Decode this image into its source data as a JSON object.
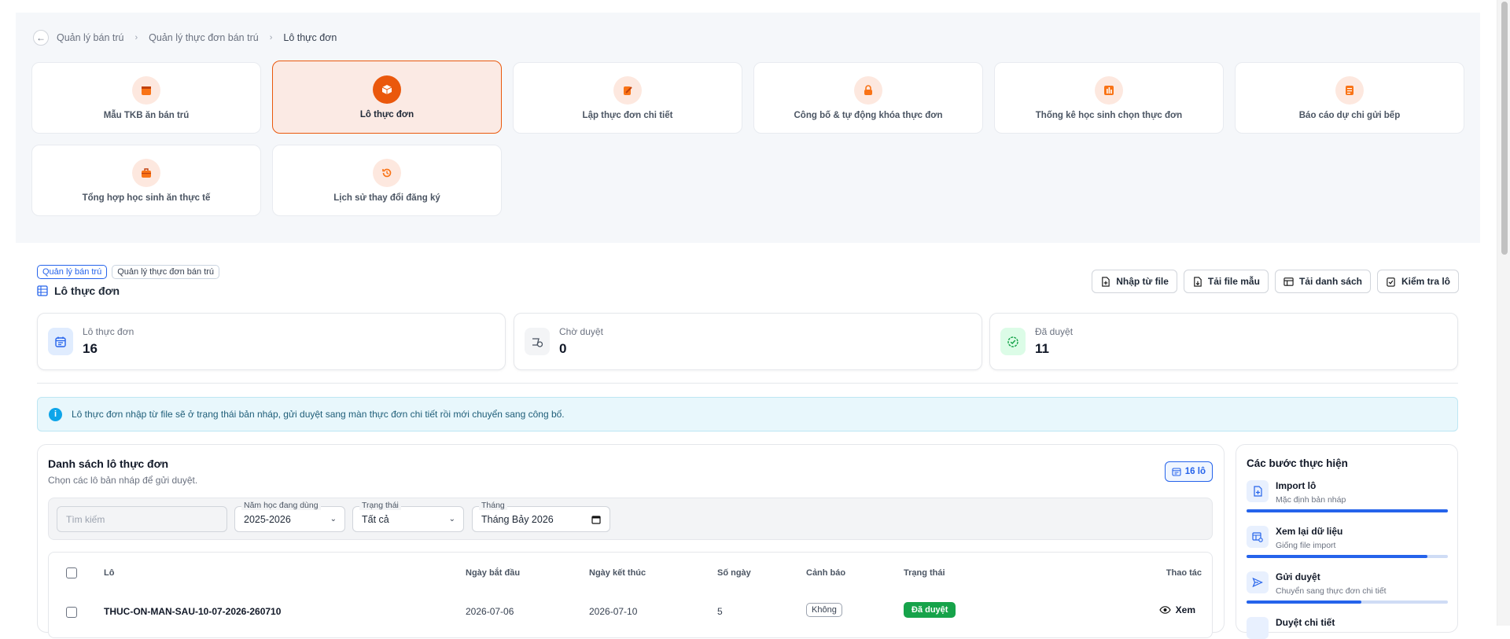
{
  "breadcrumb": [
    "Quản lý bán trú",
    "Quản lý thực đơn bán trú",
    "Lô thực đơn"
  ],
  "tiles": [
    {
      "label": "Mẫu TKB ăn bán trú",
      "icon": "calendar-icon",
      "active": false
    },
    {
      "label": "Lô thực đơn",
      "icon": "box-icon",
      "active": true
    },
    {
      "label": "Lập thực đơn chi tiết",
      "icon": "edit-menu-icon",
      "active": false
    },
    {
      "label": "Công bố & tự động khóa thực đơn",
      "icon": "lock-icon",
      "active": false
    },
    {
      "label": "Thống kê học sinh chọn thực đơn",
      "icon": "chart-icon",
      "active": false
    },
    {
      "label": "Báo cáo dự chi gửi bếp",
      "icon": "report-icon",
      "active": false
    },
    {
      "label": "Tổng hợp học sinh ăn thực tế",
      "icon": "briefcase-icon",
      "active": false
    },
    {
      "label": "Lịch sử thay đổi đăng ký",
      "icon": "history-icon",
      "active": false
    }
  ],
  "chips": [
    "Quản lý bán trú",
    "Quản lý thực đơn bán trú"
  ],
  "page_title": "Lô thực đơn",
  "actions": [
    "Nhập từ file",
    "Tải file mẫu",
    "Tải danh sách",
    "Kiểm tra lô"
  ],
  "stats": [
    {
      "label": "Lô thực đơn",
      "value": "16",
      "color": "#2563eb"
    },
    {
      "label": "Chờ duyệt",
      "value": "0",
      "color": "#6b7280"
    },
    {
      "label": "Đã duyệt",
      "value": "11",
      "color": "#16a34a"
    }
  ],
  "info_text": "Lô thực đơn nhập từ file sẽ ở trạng thái bản nháp, gửi duyệt sang màn thực đơn chi tiết rồi mới chuyển sang công bố.",
  "list": {
    "title": "Danh sách lô thực đơn",
    "subtitle": "Chọn các lô bản nháp để gửi duyệt.",
    "count_badge": "16 lô",
    "search_placeholder": "Tìm kiếm",
    "filters": {
      "year_label": "Năm học đang dùng",
      "year_value": "2025-2026",
      "status_label": "Trạng thái",
      "status_value": "Tất cả",
      "month_label": "Tháng",
      "month_value": "Tháng Bảy 2026"
    },
    "columns": [
      "Lô",
      "Ngày bắt đầu",
      "Ngày kết thúc",
      "Số ngày",
      "Cảnh báo",
      "Trạng thái",
      "Thao tác"
    ],
    "rows": [
      {
        "lo": "THUC-ON-MAN-SAU-10-07-2026-260710",
        "start": "2026-07-06",
        "end": "2026-07-10",
        "days": "5",
        "warning": "Không",
        "status": "Đã duyệt",
        "action": "Xem"
      }
    ]
  },
  "steps": {
    "title": "Các bước thực hiện",
    "items": [
      {
        "name": "Import lô",
        "desc": "Mặc định bản nháp",
        "progress": 1.0
      },
      {
        "name": "Xem lại dữ liệu",
        "desc": "Giống file import",
        "progress": 0.9
      },
      {
        "name": "Gửi duyệt",
        "desc": "Chuyển sang thực đơn chi tiết",
        "progress": 0.57
      },
      {
        "name": "Duyệt chi tiết",
        "desc": "",
        "progress": 0.0
      }
    ]
  },
  "colors": {
    "accent": "#ea580c",
    "primary": "#2563eb",
    "success": "#16a34a"
  }
}
